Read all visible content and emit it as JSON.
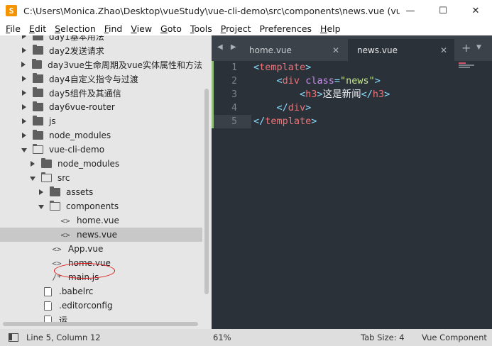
{
  "window": {
    "title": "C:\\Users\\Monica.Zhao\\Desktop\\vueStudy\\vue-cli-demo\\src\\components\\news.vue (vueS...",
    "controls": {
      "minimize": "—",
      "maximize": "☐",
      "close": "✕"
    }
  },
  "menu": {
    "items": [
      {
        "acc": "F",
        "rest": "ile"
      },
      {
        "acc": "E",
        "rest": "dit"
      },
      {
        "acc": "S",
        "rest": "election"
      },
      {
        "acc": "F",
        "rest": "ind"
      },
      {
        "acc": "V",
        "rest": "iew"
      },
      {
        "acc": "G",
        "rest": "oto"
      },
      {
        "acc": "T",
        "rest": "ools"
      },
      {
        "acc": "P",
        "rest": "roject"
      },
      {
        "acc": "",
        "rest": "Preferences"
      },
      {
        "acc": "H",
        "rest": "elp"
      }
    ]
  },
  "sidebar": {
    "rows": [
      {
        "label": "day1基本用法",
        "kind": "folder",
        "open": false,
        "depth": 0
      },
      {
        "label": "day2发送请求",
        "kind": "folder",
        "open": false,
        "depth": 0
      },
      {
        "label": "day3vue生命周期及vue实体属性和方法",
        "kind": "folder",
        "open": false,
        "depth": 0
      },
      {
        "label": "day4自定义指令与过渡",
        "kind": "folder",
        "open": false,
        "depth": 0
      },
      {
        "label": "day5组件及其通信",
        "kind": "folder",
        "open": false,
        "depth": 0
      },
      {
        "label": "day6vue-router",
        "kind": "folder",
        "open": false,
        "depth": 0
      },
      {
        "label": "js",
        "kind": "folder",
        "open": false,
        "depth": 0
      },
      {
        "label": "node_modules",
        "kind": "folder",
        "open": false,
        "depth": 0
      },
      {
        "label": "vue-cli-demo",
        "kind": "folder",
        "open": true,
        "depth": 0
      },
      {
        "label": "node_modules",
        "kind": "folder",
        "open": false,
        "depth": 1
      },
      {
        "label": "src",
        "kind": "folder",
        "open": true,
        "depth": 1
      },
      {
        "label": "assets",
        "kind": "folder",
        "open": false,
        "depth": 2
      },
      {
        "label": "components",
        "kind": "folder",
        "open": true,
        "depth": 2
      },
      {
        "label": "home.vue",
        "kind": "vue",
        "depth": 3
      },
      {
        "label": "news.vue",
        "kind": "vue",
        "depth": 3,
        "selected": true
      },
      {
        "label": "App.vue",
        "kind": "vue",
        "depth": 2
      },
      {
        "label": "home.vue",
        "kind": "vue",
        "depth": 2
      },
      {
        "label": "main.js",
        "kind": "js",
        "depth": 2
      },
      {
        "label": ".babelrc",
        "kind": "doc",
        "depth": 1
      },
      {
        "label": ".editorconfig",
        "kind": "doc",
        "depth": 1
      },
      {
        "label": "运...",
        "kind": "doc",
        "depth": 1
      }
    ]
  },
  "tabs": {
    "nav": "◀ ▶",
    "items": [
      {
        "label": "home.vue",
        "active": false
      },
      {
        "label": "news.vue",
        "active": true
      }
    ],
    "close_glyph": "✕",
    "add": "+",
    "more": "▼"
  },
  "editor": {
    "line_numbers": [
      "1",
      "2",
      "3",
      "4",
      "5"
    ],
    "current_line": 5
  },
  "status": {
    "position": "Line 5, Column 12",
    "zoom": "61%",
    "tab_size": "Tab Size: 4",
    "syntax": "Vue Component"
  }
}
